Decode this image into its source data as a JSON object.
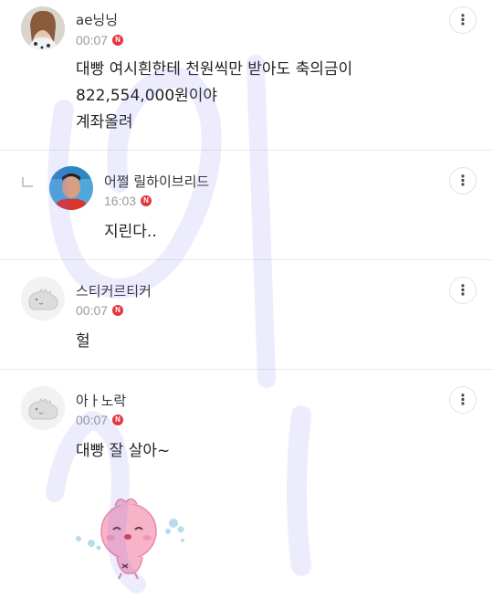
{
  "comments": [
    {
      "username": "ae닝닝",
      "time": "00:07",
      "badge": "N",
      "lines": [
        "대빵 여시흰한테 천원씩만 받아도 축의금이",
        "822,554,000원이야",
        "계좌올려"
      ],
      "avatar_icon": "profile-photo-icon",
      "more_icon": "more-vertical-icon"
    },
    {
      "username": "어쩔 릴하이브리드",
      "time": "16:03",
      "badge": "N",
      "lines": [
        "지린다.."
      ],
      "is_reply": true,
      "reply_icon": "reply-arrow-icon",
      "avatar_icon": "profile-photo-icon",
      "more_icon": "more-vertical-icon"
    },
    {
      "username": "스티커르티커",
      "time": "00:07",
      "badge": "N",
      "lines": [
        "헐"
      ],
      "avatar_icon": "default-dino-avatar-icon",
      "more_icon": "more-vertical-icon"
    },
    {
      "username": "아ㅏ노락",
      "time": "00:07",
      "badge": "N",
      "lines": [
        "대빵 잘 살아~"
      ],
      "avatar_icon": "default-dino-avatar-icon",
      "more_icon": "more-vertical-icon",
      "sticker_icon": "pink-character-sticker-icon"
    }
  ],
  "more_glyph": "⋮",
  "colors": {
    "badge": "#e5343f",
    "time": "#9a9a9a",
    "divider": "#ececec",
    "watermark": "#6f6ff0"
  }
}
